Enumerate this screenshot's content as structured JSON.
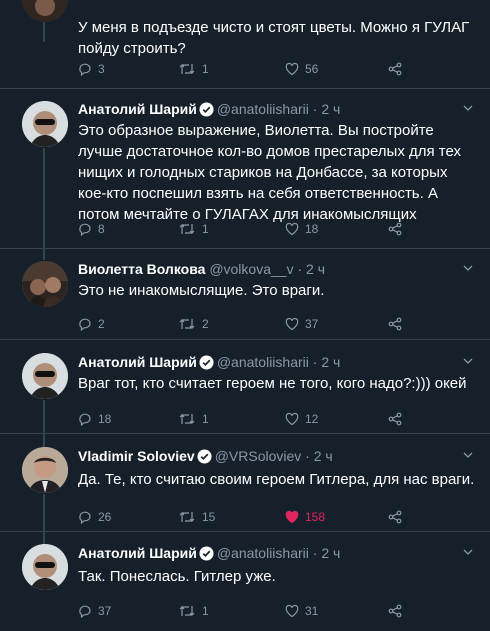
{
  "tweets": [
    {
      "text": "У меня в подъезде чисто и стоят цветы. Можно я ГУЛАГ пойду строить?",
      "replies": "3",
      "retweets": "1",
      "likes": "56"
    },
    {
      "name": "Анатолий Шарий",
      "handle": "@anatoliisharii",
      "time": "2 ч",
      "text": "Это образное выражение, Виолетта. Вы постройте лучше достаточное кол-во домов престарелых для тех нищих и голодных стариков на Донбассе, за которых кое-кто поспешил взять на себя ответственность. А потом мечтайте о ГУЛАГАХ для инакомыслящих",
      "replies": "8",
      "retweets": "1",
      "likes": "18"
    },
    {
      "name": "Виолетта Волкова",
      "handle": "@volkova__v",
      "time": "2 ч",
      "text": "Это не инакомыслящие. Это враги.",
      "replies": "2",
      "retweets": "2",
      "likes": "37"
    },
    {
      "name": "Анатолий Шарий",
      "handle": "@anatoliisharii",
      "time": "2 ч",
      "text": "Враг тот, кто считает героем не того, кого надо?:))) окей",
      "replies": "18",
      "retweets": "1",
      "likes": "12"
    },
    {
      "name": "Vladimir Soloviev",
      "handle": "@VRSoloviev",
      "time": "2 ч",
      "text": "Да. Те, кто считаю своим героем Гитлера, для нас враги.",
      "replies": "26",
      "retweets": "15",
      "likes": "158"
    },
    {
      "name": "Анатолий Шарий",
      "handle": "@anatoliisharii",
      "time": "2 ч",
      "text": "Так. Понеслась. Гитлер уже.",
      "replies": "37",
      "retweets": "1",
      "likes": "31"
    }
  ],
  "colors": {
    "background": "#15202b",
    "secondary_text": "#8899a6",
    "verified": "#1da1f2",
    "like_active": "#e0245e",
    "separator": "#38444d"
  },
  "icons": [
    "reply-icon",
    "retweet-icon",
    "like-icon",
    "share-icon",
    "verified-icon",
    "chevron-down-icon"
  ]
}
